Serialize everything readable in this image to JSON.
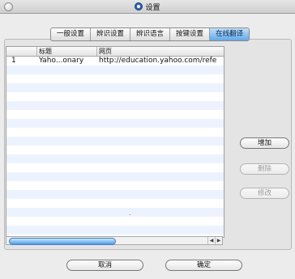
{
  "window": {
    "title": "设置"
  },
  "tabs": [
    {
      "label": "一般设置"
    },
    {
      "label": "辨识设置"
    },
    {
      "label": "辨识语言"
    },
    {
      "label": "按键设置"
    },
    {
      "label": "在线翻译",
      "active": true
    }
  ],
  "table": {
    "columns": [
      "标题",
      "网页"
    ],
    "rows": [
      {
        "index": "1",
        "title": "Yaho...onary",
        "url": "http://education.yahoo.com/refe"
      }
    ]
  },
  "side_buttons": {
    "add": "增加",
    "delete": "删除",
    "edit": "修改"
  },
  "footer": {
    "cancel": "取消",
    "ok": "确定"
  }
}
